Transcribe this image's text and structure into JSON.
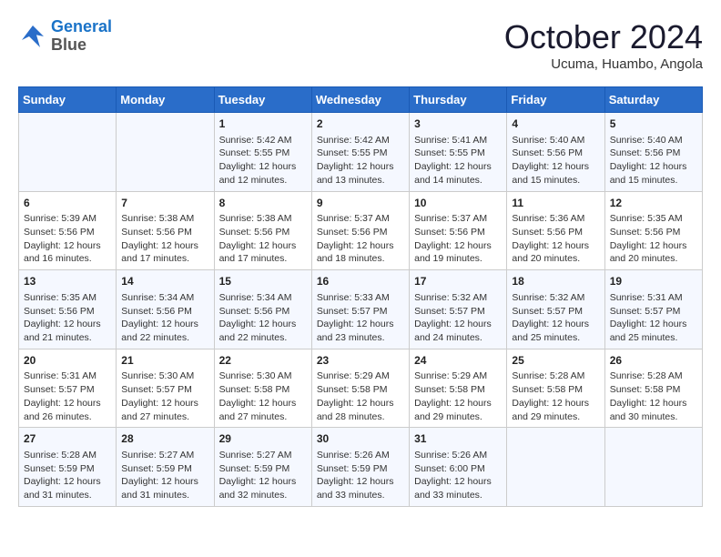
{
  "logo": {
    "line1": "General",
    "line2": "Blue"
  },
  "title": "October 2024",
  "location": "Ucuma, Huambo, Angola",
  "days_header": [
    "Sunday",
    "Monday",
    "Tuesday",
    "Wednesday",
    "Thursday",
    "Friday",
    "Saturday"
  ],
  "weeks": [
    [
      {
        "day": "",
        "info": ""
      },
      {
        "day": "",
        "info": ""
      },
      {
        "day": "1",
        "info": "Sunrise: 5:42 AM\nSunset: 5:55 PM\nDaylight: 12 hours\nand 12 minutes."
      },
      {
        "day": "2",
        "info": "Sunrise: 5:42 AM\nSunset: 5:55 PM\nDaylight: 12 hours\nand 13 minutes."
      },
      {
        "day": "3",
        "info": "Sunrise: 5:41 AM\nSunset: 5:55 PM\nDaylight: 12 hours\nand 14 minutes."
      },
      {
        "day": "4",
        "info": "Sunrise: 5:40 AM\nSunset: 5:56 PM\nDaylight: 12 hours\nand 15 minutes."
      },
      {
        "day": "5",
        "info": "Sunrise: 5:40 AM\nSunset: 5:56 PM\nDaylight: 12 hours\nand 15 minutes."
      }
    ],
    [
      {
        "day": "6",
        "info": "Sunrise: 5:39 AM\nSunset: 5:56 PM\nDaylight: 12 hours\nand 16 minutes."
      },
      {
        "day": "7",
        "info": "Sunrise: 5:38 AM\nSunset: 5:56 PM\nDaylight: 12 hours\nand 17 minutes."
      },
      {
        "day": "8",
        "info": "Sunrise: 5:38 AM\nSunset: 5:56 PM\nDaylight: 12 hours\nand 17 minutes."
      },
      {
        "day": "9",
        "info": "Sunrise: 5:37 AM\nSunset: 5:56 PM\nDaylight: 12 hours\nand 18 minutes."
      },
      {
        "day": "10",
        "info": "Sunrise: 5:37 AM\nSunset: 5:56 PM\nDaylight: 12 hours\nand 19 minutes."
      },
      {
        "day": "11",
        "info": "Sunrise: 5:36 AM\nSunset: 5:56 PM\nDaylight: 12 hours\nand 20 minutes."
      },
      {
        "day": "12",
        "info": "Sunrise: 5:35 AM\nSunset: 5:56 PM\nDaylight: 12 hours\nand 20 minutes."
      }
    ],
    [
      {
        "day": "13",
        "info": "Sunrise: 5:35 AM\nSunset: 5:56 PM\nDaylight: 12 hours\nand 21 minutes."
      },
      {
        "day": "14",
        "info": "Sunrise: 5:34 AM\nSunset: 5:56 PM\nDaylight: 12 hours\nand 22 minutes."
      },
      {
        "day": "15",
        "info": "Sunrise: 5:34 AM\nSunset: 5:56 PM\nDaylight: 12 hours\nand 22 minutes."
      },
      {
        "day": "16",
        "info": "Sunrise: 5:33 AM\nSunset: 5:57 PM\nDaylight: 12 hours\nand 23 minutes."
      },
      {
        "day": "17",
        "info": "Sunrise: 5:32 AM\nSunset: 5:57 PM\nDaylight: 12 hours\nand 24 minutes."
      },
      {
        "day": "18",
        "info": "Sunrise: 5:32 AM\nSunset: 5:57 PM\nDaylight: 12 hours\nand 25 minutes."
      },
      {
        "day": "19",
        "info": "Sunrise: 5:31 AM\nSunset: 5:57 PM\nDaylight: 12 hours\nand 25 minutes."
      }
    ],
    [
      {
        "day": "20",
        "info": "Sunrise: 5:31 AM\nSunset: 5:57 PM\nDaylight: 12 hours\nand 26 minutes."
      },
      {
        "day": "21",
        "info": "Sunrise: 5:30 AM\nSunset: 5:57 PM\nDaylight: 12 hours\nand 27 minutes."
      },
      {
        "day": "22",
        "info": "Sunrise: 5:30 AM\nSunset: 5:58 PM\nDaylight: 12 hours\nand 27 minutes."
      },
      {
        "day": "23",
        "info": "Sunrise: 5:29 AM\nSunset: 5:58 PM\nDaylight: 12 hours\nand 28 minutes."
      },
      {
        "day": "24",
        "info": "Sunrise: 5:29 AM\nSunset: 5:58 PM\nDaylight: 12 hours\nand 29 minutes."
      },
      {
        "day": "25",
        "info": "Sunrise: 5:28 AM\nSunset: 5:58 PM\nDaylight: 12 hours\nand 29 minutes."
      },
      {
        "day": "26",
        "info": "Sunrise: 5:28 AM\nSunset: 5:58 PM\nDaylight: 12 hours\nand 30 minutes."
      }
    ],
    [
      {
        "day": "27",
        "info": "Sunrise: 5:28 AM\nSunset: 5:59 PM\nDaylight: 12 hours\nand 31 minutes."
      },
      {
        "day": "28",
        "info": "Sunrise: 5:27 AM\nSunset: 5:59 PM\nDaylight: 12 hours\nand 31 minutes."
      },
      {
        "day": "29",
        "info": "Sunrise: 5:27 AM\nSunset: 5:59 PM\nDaylight: 12 hours\nand 32 minutes."
      },
      {
        "day": "30",
        "info": "Sunrise: 5:26 AM\nSunset: 5:59 PM\nDaylight: 12 hours\nand 33 minutes."
      },
      {
        "day": "31",
        "info": "Sunrise: 5:26 AM\nSunset: 6:00 PM\nDaylight: 12 hours\nand 33 minutes."
      },
      {
        "day": "",
        "info": ""
      },
      {
        "day": "",
        "info": ""
      }
    ]
  ]
}
